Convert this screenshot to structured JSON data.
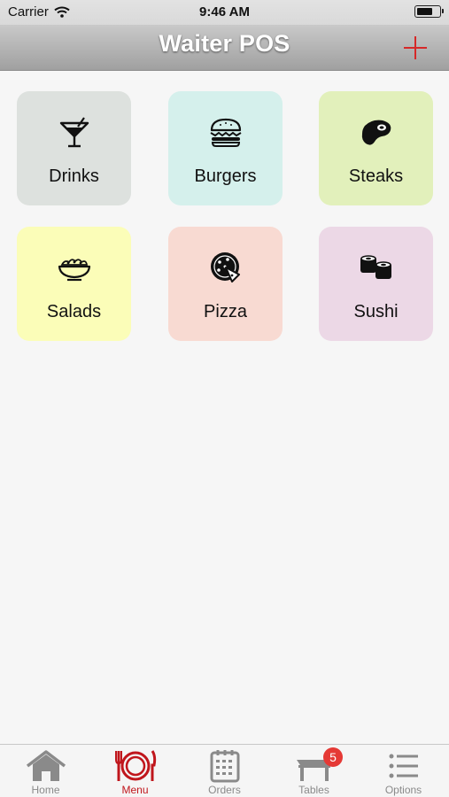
{
  "status_bar": {
    "carrier": "Carrier",
    "time": "9:46 AM",
    "battery_level": 0.72
  },
  "nav": {
    "title": "Waiter POS",
    "add_icon": "plus-icon"
  },
  "categories": [
    {
      "label": "Drinks",
      "icon": "martini-glass-icon",
      "color": "#dde1de"
    },
    {
      "label": "Burgers",
      "icon": "burger-icon",
      "color": "#d5f0ec"
    },
    {
      "label": "Steaks",
      "icon": "steak-icon",
      "color": "#e2f0bb"
    },
    {
      "label": "Salads",
      "icon": "salad-bowl-icon",
      "color": "#fbfdb8"
    },
    {
      "label": "Pizza",
      "icon": "pizza-icon",
      "color": "#f8dad2"
    },
    {
      "label": "Sushi",
      "icon": "sushi-icon",
      "color": "#ecd8e6"
    }
  ],
  "tab_bar": {
    "active_color": "#c0161c",
    "inactive_color": "#8a8a8a",
    "tabs": [
      {
        "label": "Home",
        "icon": "home-icon"
      },
      {
        "label": "Menu",
        "icon": "plate-cutlery-icon",
        "active": true
      },
      {
        "label": "Orders",
        "icon": "orders-clipboard-icon"
      },
      {
        "label": "Tables",
        "icon": "table-icon",
        "badge": "5"
      },
      {
        "label": "Options",
        "icon": "list-icon"
      }
    ]
  }
}
